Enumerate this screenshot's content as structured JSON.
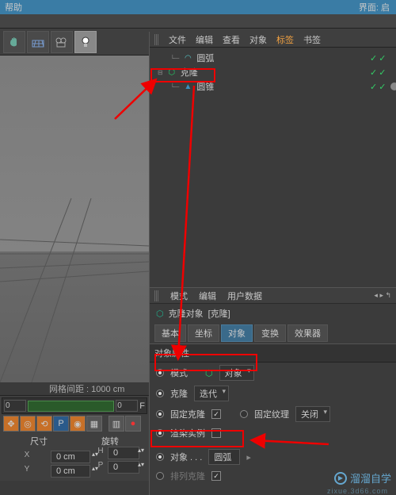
{
  "topbar": {
    "left_label": "帮助",
    "right_label": "界面: 启"
  },
  "toolbar_icons": [
    "hand-icon",
    "grid-icon",
    "camera-icon",
    "light-icon"
  ],
  "object_menu": {
    "items": [
      "文件",
      "编辑",
      "查看",
      "对象",
      "标签",
      "书签"
    ]
  },
  "tree": {
    "items": [
      {
        "name": "圆弧",
        "icon": "arc-icon",
        "level": 1
      },
      {
        "name": "克隆",
        "icon": "cloner-icon",
        "level": 0
      },
      {
        "name": "圆锥",
        "icon": "cone-icon",
        "level": 1
      }
    ]
  },
  "grid_info": "网格间距 : 1000 cm",
  "attr_menu": {
    "items": [
      "模式",
      "编辑",
      "用户数据"
    ]
  },
  "attr": {
    "title_label": "克隆对象",
    "title_suffix": "[克隆]",
    "tabs": [
      "基本",
      "坐标",
      "对象",
      "变换",
      "效果器"
    ],
    "section": "对象属性",
    "mode_label": "模式",
    "mode_value": "对象",
    "clone_label": "克隆",
    "clone_value": "迭代",
    "fixclone_label": "固定克隆",
    "fixtex_label": "固定纹理",
    "fixtex_value": "关闭",
    "render_label": "渲染实例",
    "object_label": "对象 . . .",
    "object_value": "圆弧",
    "arrange_label": "排列克隆"
  },
  "bottom": {
    "timeline_zero": "0",
    "timeline_f_suffix": "F",
    "dim_header": "尺寸",
    "rot_header": "旋转",
    "x_val": "0 cm",
    "y_val": "0 cm",
    "h_val": "0 ",
    "p_val": "0 "
  },
  "watermark": {
    "brand": "溜溜自学",
    "url": "zixue.3d66.com"
  }
}
